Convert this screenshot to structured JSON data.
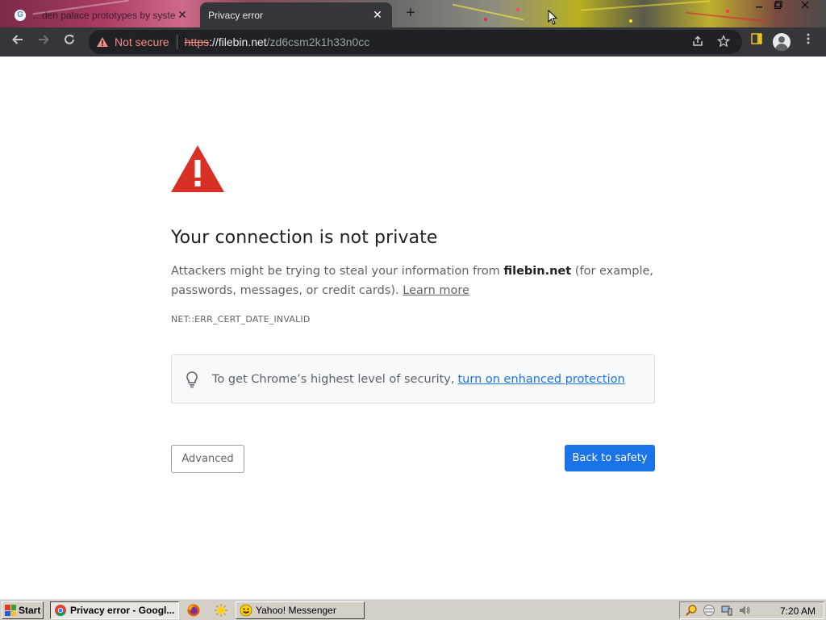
{
  "browser": {
    "tabs": [
      {
        "title": "…den palace prototypes by syste…",
        "active": false,
        "close": "✕"
      },
      {
        "title": "Privacy error",
        "active": true,
        "close": "✕"
      }
    ],
    "new_tab": "+",
    "address_bar": {
      "security_label": "Not secure",
      "scheme": "https",
      "host": "filebin.net",
      "path": "/zd6csm2k1h33n0cc"
    }
  },
  "interstitial": {
    "heading": "Your connection is not private",
    "message_before": "Attackers might be trying to steal your information from ",
    "message_host": "filebin.net",
    "message_after": " (for example, passwords, messages, or credit cards). ",
    "learn_more": "Learn more",
    "error_code": "NET::ERR_CERT_DATE_INVALID",
    "enhanced_text": "To get Chrome’s highest level of security,",
    "enhanced_link": "turn on enhanced protection",
    "advanced_label": "Advanced",
    "back_label": "Back to safety"
  },
  "taskbar": {
    "start_label": "Start",
    "buttons": [
      {
        "label": "Privacy error - Googl...",
        "active": true
      },
      {
        "label": "Yahoo! Messenger",
        "active": false
      }
    ],
    "clock": "7:20 AM"
  },
  "colors": {
    "toolbar": "#35363a",
    "omnibox": "#202124",
    "warning_red": "#f28b82",
    "alert_icon": "#d93025",
    "primary_blue": "#1a73e8"
  }
}
